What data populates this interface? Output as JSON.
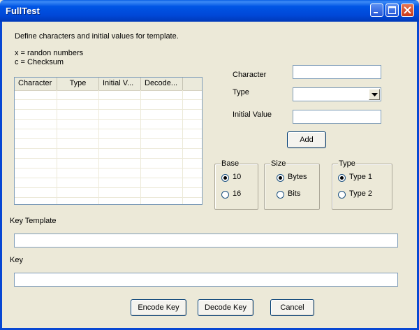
{
  "window": {
    "title": "FullTest"
  },
  "instructions": {
    "line1": "Define characters and initial values for template.",
    "line2": "x = randon numbers",
    "line3": "c = Checksum"
  },
  "table": {
    "columns": [
      "Character",
      "Type",
      "Initial V...",
      "Decode..."
    ]
  },
  "form": {
    "character_label": "Character",
    "character_value": "",
    "type_label": "Type",
    "type_value": "",
    "initial_label": "Initial Value",
    "initial_value": "",
    "add_button": "Add"
  },
  "groups": {
    "base": {
      "title": "Base",
      "options": [
        "10",
        "16"
      ],
      "selected": "10"
    },
    "size": {
      "title": "Size",
      "options": [
        "Bytes",
        "Bits"
      ],
      "selected": "Bytes"
    },
    "type": {
      "title": "Type",
      "options": [
        "Type 1",
        "Type 2"
      ],
      "selected": "Type 1"
    }
  },
  "key_template": {
    "label": "Key Template",
    "value": ""
  },
  "key": {
    "label": "Key",
    "value": ""
  },
  "buttons": {
    "encode": "Encode Key",
    "decode": "Decode Key",
    "cancel": "Cancel"
  }
}
